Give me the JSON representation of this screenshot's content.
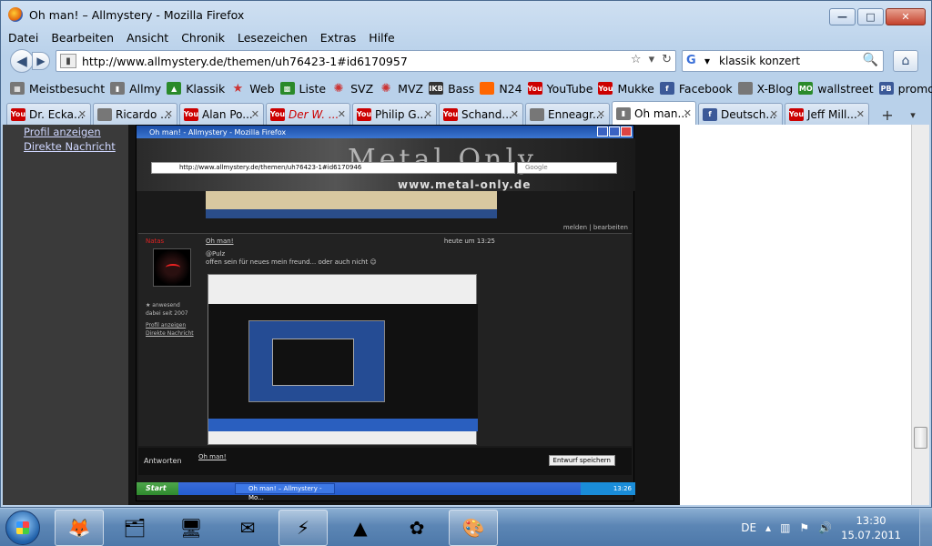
{
  "window": {
    "title": "Oh man! – Allmystery - Mozilla Firefox",
    "btn_min": "—",
    "btn_max": "□",
    "btn_close": "✕"
  },
  "menu": [
    "Datei",
    "Bearbeiten",
    "Ansicht",
    "Chronik",
    "Lesezeichen",
    "Extras",
    "Hilfe"
  ],
  "nav": {
    "back": "◀",
    "forward": "▶",
    "url": "http://www.allmystery.de/themen/uh76423-1#id6170957",
    "star": "☆",
    "dropdown": "▾",
    "reload": "↻",
    "search_value": "klassik konzert",
    "search_engine_icon": "google-icon",
    "search_go": "🔍",
    "home": "⌂"
  },
  "bookmarks": [
    {
      "label": "Meistbesucht",
      "icon": "▦",
      "style": "gray"
    },
    {
      "label": "Allmy",
      "icon": "▮",
      "style": "gray"
    },
    {
      "label": "Klassik",
      "icon": "▲",
      "style": "green"
    },
    {
      "label": "Web",
      "icon": "★",
      "style": "star"
    },
    {
      "label": "Liste",
      "icon": "▩",
      "style": "green"
    },
    {
      "label": "SVZ",
      "icon": "✺",
      "style": "star"
    },
    {
      "label": "MVZ",
      "icon": "✺",
      "style": "star"
    },
    {
      "label": "Bass",
      "icon": "IKB",
      "style": "dark"
    },
    {
      "label": "N24",
      "icon": "",
      "style": "orange"
    },
    {
      "label": "YouTube",
      "icon": "You",
      "style": "yt"
    },
    {
      "label": "Mukke",
      "icon": "You",
      "style": "yt"
    },
    {
      "label": "Facebook",
      "icon": "f",
      "style": "blue"
    },
    {
      "label": "X-Blog",
      "icon": "",
      "style": "gray"
    },
    {
      "label": "wallstreet",
      "icon": "MO",
      "style": "green"
    },
    {
      "label": "promo",
      "icon": "PB",
      "style": "blue"
    }
  ],
  "tabs": [
    {
      "label": "Dr. Ecka...",
      "icon": "You",
      "style": "yt",
      "red": false,
      "active": false
    },
    {
      "label": "Ricardo ...",
      "icon": "",
      "style": "gray",
      "red": false,
      "active": false
    },
    {
      "label": "Alan Po...",
      "icon": "You",
      "style": "yt",
      "red": false,
      "active": false
    },
    {
      "label": "Der W. ...",
      "icon": "You",
      "style": "yt",
      "red": true,
      "active": false
    },
    {
      "label": "Philip G...",
      "icon": "You",
      "style": "yt",
      "red": false,
      "active": false
    },
    {
      "label": "Schand...",
      "icon": "You",
      "style": "yt",
      "red": false,
      "active": false
    },
    {
      "label": "Enneagr...",
      "icon": "",
      "style": "gray",
      "red": false,
      "active": false
    },
    {
      "label": "Oh man...",
      "icon": "▮",
      "style": "gray",
      "red": false,
      "active": true
    },
    {
      "label": "Deutsch...",
      "icon": "f",
      "style": "blue",
      "red": false,
      "active": false
    },
    {
      "label": "Jeff Mill...",
      "icon": "You",
      "style": "yt",
      "red": false,
      "active": false
    }
  ],
  "tab_close": "✕",
  "tab_new": "+",
  "tab_list": "▾",
  "sidebar": {
    "links": [
      "Profil anzeigen",
      "Direkte Nachricht"
    ]
  },
  "nested": {
    "title": "Oh man! - Allmystery - Mozilla Firefox",
    "url": "http://www.allmystery.de/themen/uh76423-1#id6170946",
    "search": "Google",
    "banner_title": "Metal Only",
    "banner_sub": "www.metal-only.de",
    "post_links": "melden | bearbeiten",
    "username": "Natas",
    "user_status": "★ anwesend",
    "user_since": "dabei seit 2007",
    "profile_link": "Profil anzeigen",
    "pm_link": "Direkte Nachricht",
    "post_title": "Oh man!",
    "post_time": "heute um 13:25",
    "post_quote": "@Pulz",
    "post_text": "offen sein für neues mein freund... oder auch nicht ☺",
    "reply_label": "Antworten",
    "reply_link": "Oh man!",
    "draft_button": "Entwurf speichern",
    "start": "Start",
    "task": "Oh man! – Allmystery - Mo...",
    "clock": "13:26"
  },
  "taskbar": {
    "apps": [
      {
        "name": "firefox",
        "glyph": "🦊",
        "open": true
      },
      {
        "name": "explorer",
        "glyph": "🗂",
        "open": false
      },
      {
        "name": "remote",
        "glyph": "🖥",
        "open": false
      },
      {
        "name": "thunderbird",
        "glyph": "✉",
        "open": false
      },
      {
        "name": "winamp",
        "glyph": "⚡",
        "open": true
      },
      {
        "name": "vlc",
        "glyph": "▲",
        "open": false
      },
      {
        "name": "icq",
        "glyph": "✿",
        "open": false
      },
      {
        "name": "paint",
        "glyph": "🎨",
        "open": true
      }
    ],
    "lang": "DE",
    "time": "13:30",
    "date": "15.07.2011"
  },
  "colors": {
    "accent": "#3b75d0",
    "page_bg": "#141414"
  }
}
